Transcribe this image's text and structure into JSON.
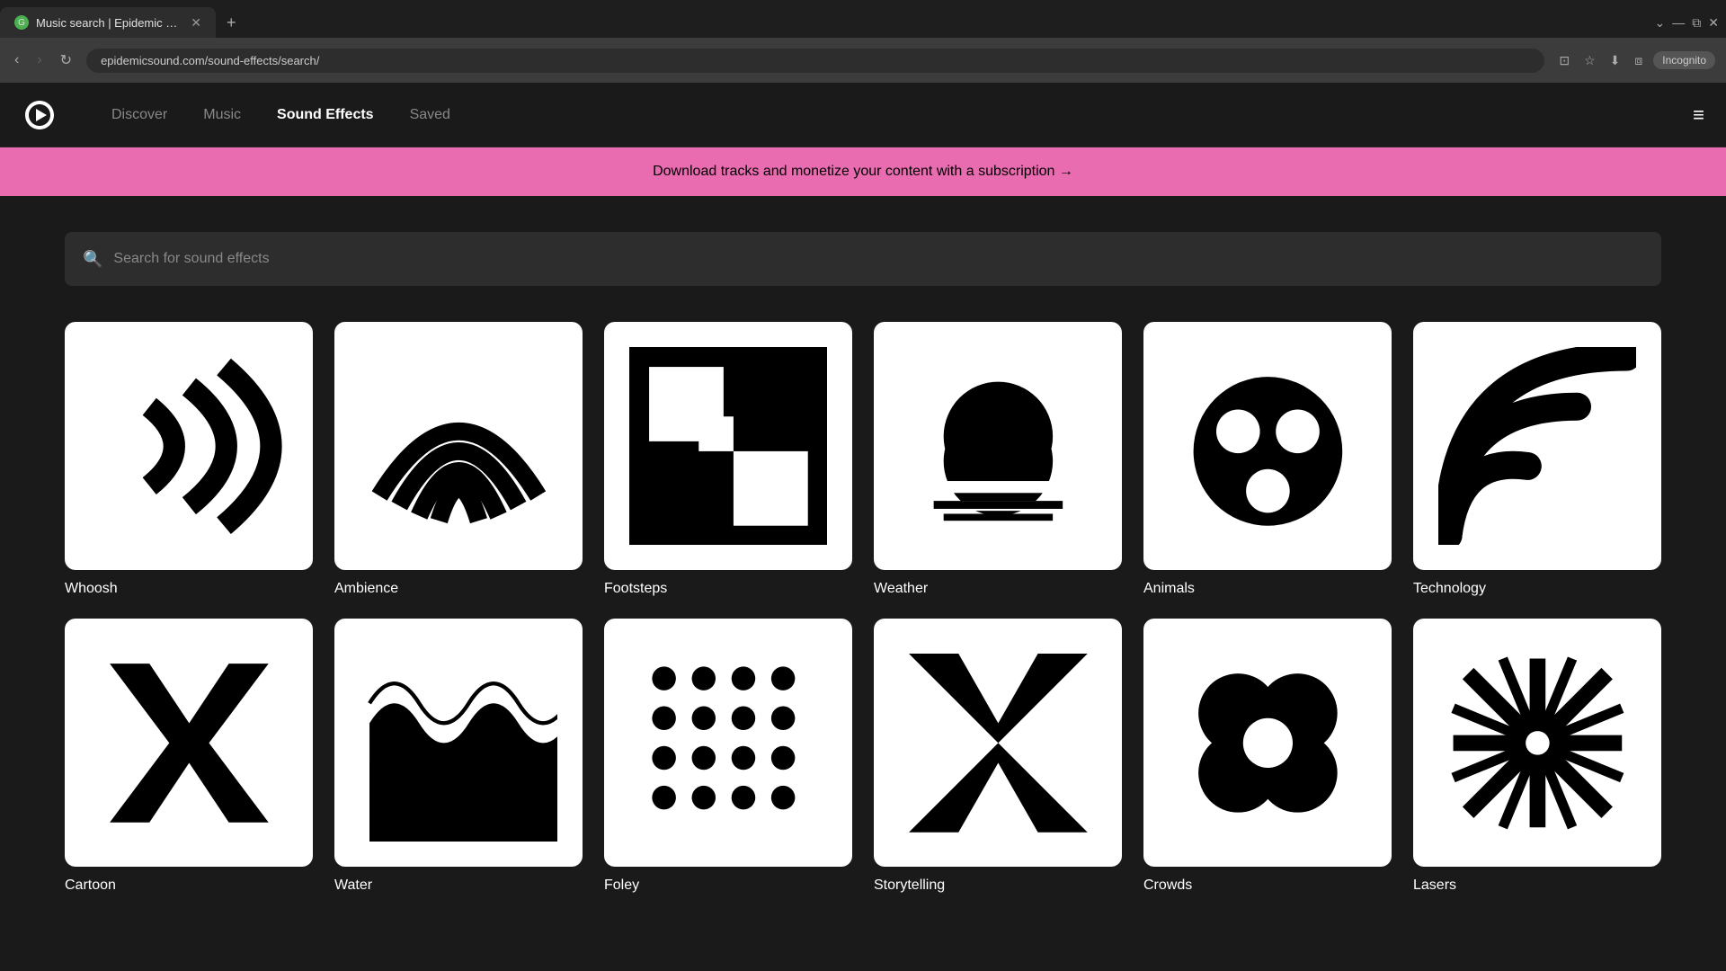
{
  "browser": {
    "tab_title": "Music search | Epidemic Sound",
    "tab_favicon": "G",
    "url": "epidemicsound.com/sound-effects/search/",
    "incognito_label": "Incognito"
  },
  "nav": {
    "discover": "Discover",
    "music": "Music",
    "sound_effects": "Sound Effects",
    "saved": "Saved"
  },
  "promo": {
    "text": "Download tracks and monetize your content with a subscription →"
  },
  "search": {
    "placeholder": "Search for sound effects"
  },
  "categories": [
    {
      "id": "whoosh",
      "label": "Whoosh"
    },
    {
      "id": "ambience",
      "label": "Ambience"
    },
    {
      "id": "footsteps",
      "label": "Footsteps"
    },
    {
      "id": "weather",
      "label": "Weather"
    },
    {
      "id": "animals",
      "label": "Animals"
    },
    {
      "id": "technology",
      "label": "Technology"
    },
    {
      "id": "cartoon",
      "label": "Cartoon"
    },
    {
      "id": "water",
      "label": "Water"
    },
    {
      "id": "foley",
      "label": "Foley"
    },
    {
      "id": "storytelling",
      "label": "Storytelling"
    },
    {
      "id": "crowds",
      "label": "Crowds"
    },
    {
      "id": "lasers",
      "label": "Lasers"
    }
  ]
}
